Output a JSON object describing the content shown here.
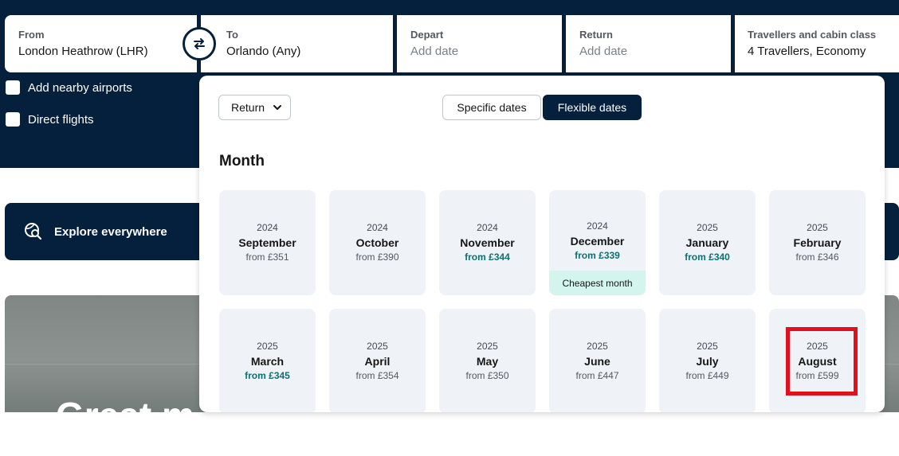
{
  "search": {
    "from": {
      "label": "From",
      "value": "London Heathrow (LHR)"
    },
    "to": {
      "label": "To",
      "value": "Orlando (Any)"
    },
    "depart": {
      "label": "Depart",
      "placeholder": "Add date"
    },
    "return": {
      "label": "Return",
      "placeholder": "Add date"
    },
    "travellers": {
      "label": "Travellers and cabin class",
      "value": "4 Travellers, Economy"
    },
    "swap_icon": "swap-arrows-icon"
  },
  "options": {
    "nearby": "Add nearby airports",
    "direct": "Direct flights"
  },
  "explore": {
    "label": "Explore everywhere",
    "icon": "globe-search-icon"
  },
  "hero": {
    "headline": "Great m"
  },
  "popup": {
    "trip_type": "Return",
    "segments": {
      "specific": "Specific dates",
      "flexible": "Flexible dates",
      "active": "flexible"
    },
    "heading": "Month",
    "months": [
      {
        "year": "2024",
        "month": "September",
        "price": "from £351",
        "cheap": false
      },
      {
        "year": "2024",
        "month": "October",
        "price": "from £390",
        "cheap": false
      },
      {
        "year": "2024",
        "month": "November",
        "price": "from £344",
        "cheap": true
      },
      {
        "year": "2024",
        "month": "December",
        "price": "from £339",
        "cheap": true,
        "badge": "Cheapest month"
      },
      {
        "year": "2025",
        "month": "January",
        "price": "from £340",
        "cheap": true
      },
      {
        "year": "2025",
        "month": "February",
        "price": "from £346",
        "cheap": false
      },
      {
        "year": "2025",
        "month": "March",
        "price": "from £345",
        "cheap": true
      },
      {
        "year": "2025",
        "month": "April",
        "price": "from £354",
        "cheap": false
      },
      {
        "year": "2025",
        "month": "May",
        "price": "from £350",
        "cheap": false
      },
      {
        "year": "2025",
        "month": "June",
        "price": "from £447",
        "cheap": false
      },
      {
        "year": "2025",
        "month": "July",
        "price": "from £449",
        "cheap": false
      },
      {
        "year": "2025",
        "month": "August",
        "price": "from £599",
        "cheap": false
      }
    ]
  },
  "colors": {
    "navy": "#05203c",
    "cheap_price": "#0c7072",
    "cheapest_badge": "#d3f5ee",
    "highlight": "#e0101c"
  }
}
